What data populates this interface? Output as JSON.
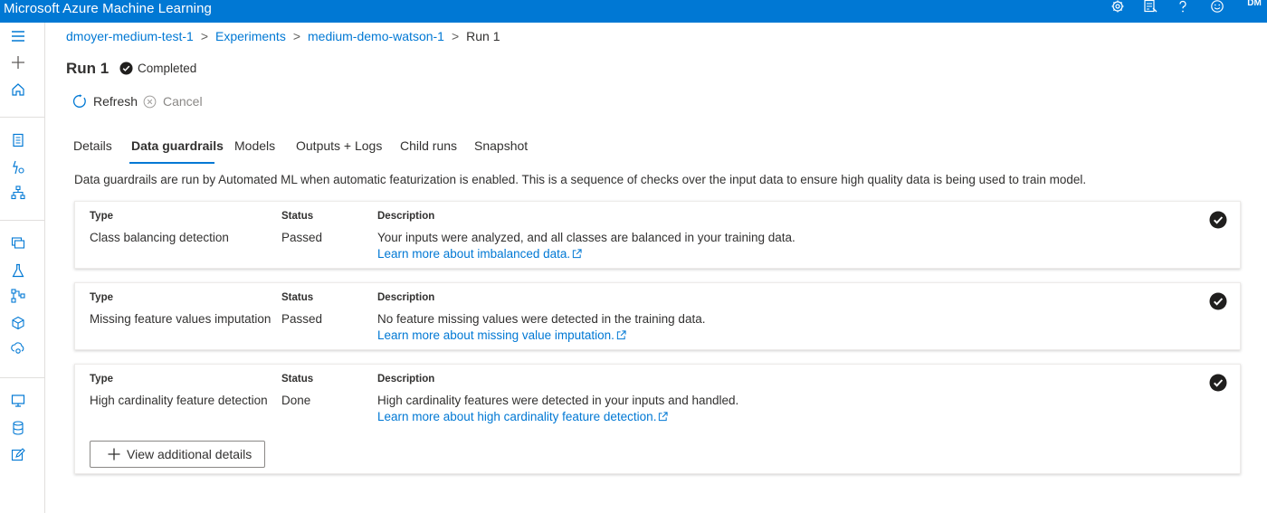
{
  "app": {
    "title": "Microsoft Azure Machine Learning",
    "user_initials": "DM"
  },
  "topbar_icons": [
    "gear-icon",
    "feedback-icon",
    "help-icon",
    "smiley-icon"
  ],
  "sidebar_icons": [
    "menu-icon",
    "add-icon",
    "home-icon",
    "notebook-icon",
    "automl-icon",
    "designer-icon",
    "datasets-icon",
    "experiments-icon",
    "pipelines-icon",
    "models-icon",
    "endpoints-icon",
    "compute-icon",
    "datastores-icon",
    "data-labeling-icon"
  ],
  "breadcrumb": {
    "items": [
      "dmoyer-medium-test-1",
      "Experiments",
      "medium-demo-watson-1"
    ],
    "current": "Run 1",
    "separator": ">"
  },
  "run": {
    "title": "Run 1",
    "status": "Completed"
  },
  "actions": {
    "refresh": "Refresh",
    "cancel": "Cancel"
  },
  "tabs": [
    "Details",
    "Data guardrails",
    "Models",
    "Outputs + Logs",
    "Child runs",
    "Snapshot"
  ],
  "active_tab": "Data guardrails",
  "intro": "Data guardrails are run by Automated ML when automatic featurization is enabled. This is a sequence of checks over the input data to ensure high quality data is being used to train model.",
  "column_labels": {
    "type": "Type",
    "status": "Status",
    "description": "Description"
  },
  "guardrails": [
    {
      "type": "Class balancing detection",
      "status": "Passed",
      "description": "Your inputs were analyzed, and all classes are balanced in your training data.",
      "link": "Learn more about imbalanced data."
    },
    {
      "type": "Missing feature values imputation",
      "status": "Passed",
      "description": "No feature missing values were detected in the training data.",
      "link": "Learn more about missing value imputation."
    },
    {
      "type": "High cardinality feature detection",
      "status": "Done",
      "description": "High cardinality features were detected in your inputs and handled.",
      "link": "Learn more about high cardinality feature detection.",
      "button": "View additional details"
    }
  ],
  "colors": {
    "brand": "#0078d4",
    "text": "#323130",
    "muted": "#8a8886"
  }
}
